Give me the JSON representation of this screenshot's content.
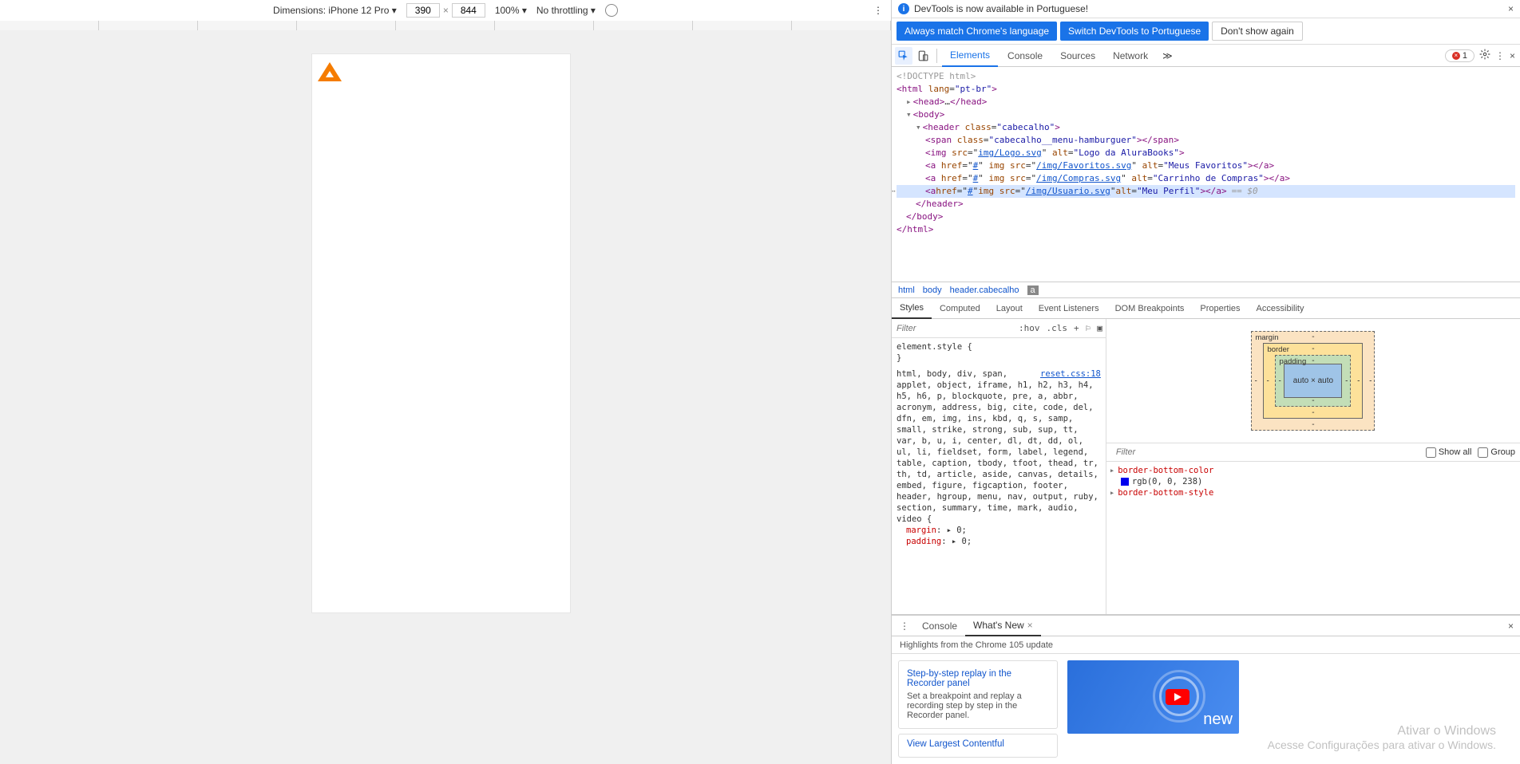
{
  "device_toolbar": {
    "dimensions_label": "Dimensions: iPhone 12 Pro ▾",
    "width": "390",
    "height": "844",
    "cross": "×",
    "zoom": "100% ▾",
    "throttling": "No throttling ▾"
  },
  "info_bar": {
    "message": "DevTools is now available in Portuguese!",
    "btn1": "Always match Chrome's language",
    "btn2": "Switch DevTools to Portuguese",
    "btn3": "Don't show again"
  },
  "main_tabs": {
    "elements": "Elements",
    "console": "Console",
    "sources": "Sources",
    "network": "Network",
    "more": "≫",
    "err_count": "1"
  },
  "dom": {
    "doctype": "<!DOCTYPE html>",
    "html_open": "<html lang=\"pt-br\">",
    "head": "<head>…</head>",
    "body_open": "<body>",
    "header_open": "<header class=\"cabecalho\">",
    "span_line": "<span class=\"cabecalho__menu-hamburguer\"></span>",
    "img_logo_pre": "<img src=\"",
    "img_logo_src": "img/Logo.svg",
    "img_logo_post": "\" alt=\"Logo da AluraBooks\">",
    "a_fav_pre": "<a href=\"#\" img src=\"",
    "a_fav_src": "/img/Favoritos.svg",
    "a_fav_post": "\" alt=\"Meus Favoritos\"></a>",
    "a_comp_pre": "<a href=\"#\" img src=\"",
    "a_comp_src": "/img/Compras.svg",
    "a_comp_post": "\" alt=\"Carrinho de Compras\"></a>",
    "a_usr_pre": "<a href=\"#\" img src=\"",
    "a_usr_src": "/img/Usuario.svg",
    "a_usr_post": "\" alt=\"Meu Perfil\"></a>",
    "eq0": "== $0",
    "header_close": "</header>",
    "body_close": "</body>",
    "html_close": "</html>"
  },
  "breadcrumb": {
    "i0": "html",
    "i1": "body",
    "i2": "header.cabecalho",
    "i3": "a"
  },
  "sub_tabs": {
    "styles": "Styles",
    "computed": "Computed",
    "layout": "Layout",
    "event_listeners": "Event Listeners",
    "dom_breakpoints": "DOM Breakpoints",
    "properties": "Properties",
    "accessibility": "Accessibility"
  },
  "styles": {
    "filter_placeholder": "Filter",
    "hov": ":hov",
    "cls": ".cls",
    "plus": "+",
    "element_style": "element.style {",
    "close_brace": "}",
    "selectors": "html, body, div, span, applet, object, iframe, h1, h2, h3, h4, h5, h6, p, blockquote, pre, a, abbr, acronym, address, big, cite, code, del, dfn, em, img, ins, kbd, q, s, samp, small, strike, strong, sub, sup, tt, var, b, u, i, center, dl, dt, dd, ol, ul, li, fieldset, form, label, legend, table, caption, tbody, tfoot, thead, tr, th, td, article, aside, canvas, details, embed, figure, figcaption, footer, header, hgroup, menu, nav, output, ruby, section, summary, time, mark, audio, video {",
    "reset_link": "reset.css:18",
    "margin_prop": "margin: ▸ 0;",
    "padding_prop": "padding: ▸ 0;"
  },
  "boxmodel": {
    "margin_label": "margin",
    "border_label": "border",
    "padding_label": "padding",
    "content": "auto × auto",
    "dash": "-"
  },
  "computed": {
    "filter_placeholder": "Filter",
    "show_all": "Show all",
    "group": "Group",
    "bbc_name": "border-bottom-color",
    "bbc_val": "rgb(0, 0, 238)",
    "bbs_name": "border-bottom-style"
  },
  "drawer": {
    "kebab": "⋮",
    "console": "Console",
    "whatsnew": "What's New",
    "highlights": "Highlights from the Chrome 105 update",
    "card1_title": "Step-by-step replay in the Recorder panel",
    "card1_desc": "Set a breakpoint and replay a recording step by step in the Recorder panel.",
    "card2_title": "View Largest Contentful",
    "promo_new": "new"
  },
  "watermark": {
    "line1": "Ativar o Windows",
    "line2": "Acesse Configurações para ativar o Windows."
  }
}
